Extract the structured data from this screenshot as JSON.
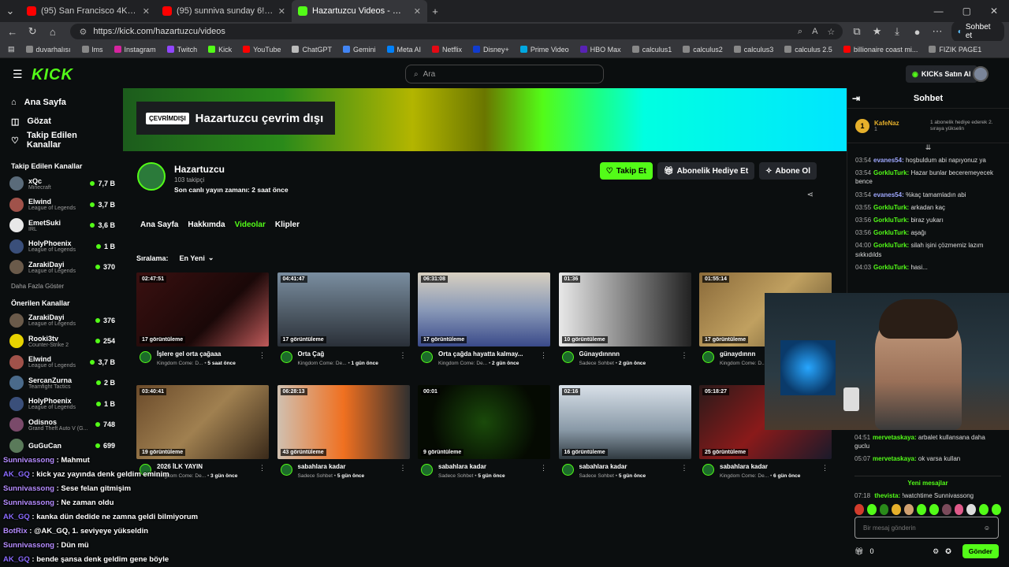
{
  "browser": {
    "tabs": [
      {
        "title": "(95) San Francisco 4K - Pacific Coa",
        "color": "#ff0000"
      },
      {
        "title": "(95) sunniva sunday 6! (singing co",
        "color": "#ff0000"
      },
      {
        "title": "Hazartuzcu Videos - Watch On-De",
        "color": "#53fc18"
      }
    ],
    "url": "https://kick.com/hazartuzcu/videos",
    "sohbet_et": "Sohbet et",
    "bookmarks": [
      {
        "label": "duvarhalısı",
        "color": "#888"
      },
      {
        "label": "lms",
        "color": "#888"
      },
      {
        "label": "Instagram",
        "color": "#d6249f"
      },
      {
        "label": "Twitch",
        "color": "#9146ff"
      },
      {
        "label": "Kick",
        "color": "#53fc18"
      },
      {
        "label": "YouTube",
        "color": "#ff0000"
      },
      {
        "label": "ChatGPT",
        "color": "#bbb"
      },
      {
        "label": "Gemini",
        "color": "#4285f4"
      },
      {
        "label": "Meta AI",
        "color": "#0081fb"
      },
      {
        "label": "Netflix",
        "color": "#e50914"
      },
      {
        "label": "Disney+",
        "color": "#113ccf"
      },
      {
        "label": "Prime Video",
        "color": "#00a8e1"
      },
      {
        "label": "HBO Max",
        "color": "#5822b4"
      },
      {
        "label": "calculus1",
        "color": "#888"
      },
      {
        "label": "calculus2",
        "color": "#888"
      },
      {
        "label": "calculus3",
        "color": "#888"
      },
      {
        "label": "calculus 2.5",
        "color": "#888"
      },
      {
        "label": "billionaire coast mi...",
        "color": "#ff0000"
      },
      {
        "label": "FIZIK PAGE1",
        "color": "#888"
      }
    ]
  },
  "header": {
    "search_placeholder": "Ara",
    "kicks_button": "KICKs Satın Al"
  },
  "sidebar": {
    "nav": [
      {
        "label": "Ana Sayfa",
        "icon": "home-icon"
      },
      {
        "label": "Gözat",
        "icon": "browse-icon"
      },
      {
        "label": "Takip Edilen Kanallar",
        "icon": "heart-icon"
      }
    ],
    "followed_heading": "Takip Edilen Kanallar",
    "followed": [
      {
        "name": "xQc",
        "game": "Minecraft",
        "viewers": "7,7 B",
        "color": "#5a6b7a"
      },
      {
        "name": "Elwind",
        "game": "League of Legends",
        "viewers": "3,7 B",
        "color": "#a0524a"
      },
      {
        "name": "EmetSuki",
        "game": "IRL",
        "viewers": "3,6 B",
        "color": "#e8e8e8"
      },
      {
        "name": "HolyPhoenix",
        "game": "League of Legends",
        "viewers": "1 B",
        "color": "#3a4f7a"
      },
      {
        "name": "ZarakiDayi",
        "game": "League of Legends",
        "viewers": "370",
        "color": "#6a5a4a"
      }
    ],
    "more_label": "Daha Fazla Göster",
    "recommended_heading": "Önerilen Kanallar",
    "recommended": [
      {
        "name": "ZarakiDayi",
        "game": "League of Legends",
        "viewers": "376",
        "color": "#6a5a4a"
      },
      {
        "name": "Rooki3tv",
        "game": "Counter-Strike 2",
        "viewers": "254",
        "color": "#e6d200"
      },
      {
        "name": "Elwind",
        "game": "League of Legends",
        "viewers": "3,7 B",
        "color": "#a0524a"
      },
      {
        "name": "SercanZurna",
        "game": "Teamfight Tactics",
        "viewers": "2 B",
        "color": "#4a6a8a"
      },
      {
        "name": "HolyPhoenix",
        "game": "League of Legends",
        "viewers": "1 B",
        "color": "#3a4f7a"
      },
      {
        "name": "Odisnos",
        "game": "Grand Theft Auto V (G...",
        "viewers": "748",
        "color": "#7a4a6a"
      },
      {
        "name": "GuGuCan",
        "game": "",
        "viewers": "699",
        "color": "#5a7a5a"
      }
    ]
  },
  "channel": {
    "offline_tag": "ÇEVRİMDIŞI",
    "offline_title": "Hazartuzcu çevrim dışı",
    "name": "Hazartuzcu",
    "followers": "103 takipçi",
    "last_stream": "Son canlı yayın zamanı: 2 saat önce",
    "follow_button": "Takip Et",
    "gift_button": "Abonelik Hediye Et",
    "subscribe_button": "Abone Ol",
    "tabs": [
      "Ana Sayfa",
      "Hakkımda",
      "Videolar",
      "Klipler"
    ],
    "sort_label": "Sıralama:",
    "sort_value": "En Yeni"
  },
  "videos": [
    {
      "duration": "02:47:51",
      "views": "17 görüntüleme",
      "title": "İşlere gel orta çağaaa",
      "game": "Kingdom Come: D...",
      "ago": "5 saat önce",
      "bg": "linear-gradient(135deg,#3a1010,#1a0808 60%,#c05a5a)"
    },
    {
      "duration": "04:41:47",
      "views": "17 görüntüleme",
      "title": "Orta Çağ",
      "game": "Kingdom Come: De...",
      "ago": "1 gün önce",
      "bg": "linear-gradient(180deg,#7a8ea0,#4a5560 60%,#2a3038)"
    },
    {
      "duration": "06:31:08",
      "views": "17 görüntüleme",
      "title": "Orta çağda hayatta kalmay...",
      "game": "Kingdom Come: De...",
      "ago": "2 gün önce",
      "bg": "linear-gradient(180deg,#d8d0c0,#8a9ab8 50%,#3a4a8a)"
    },
    {
      "duration": "01:36",
      "views": "10 görüntüleme",
      "title": "Günaydınnnn",
      "game": "Sadece Sohbet",
      "ago": "2 gün önce",
      "bg": "linear-gradient(90deg,#e8e8e8,#9a9a9a 40%,#222 100%)"
    },
    {
      "duration": "01:55:14",
      "views": "17 görüntüleme",
      "title": "günaydınnn",
      "game": "Kingdom Come: D...",
      "ago": "2 gün önce",
      "bg": "linear-gradient(135deg,#8a6a3a,#c0a060 50%,#5a4a2a)"
    },
    {
      "duration": "03:40:41",
      "views": "19 görüntüleme",
      "title": "2026 İLK YAYIN",
      "game": "Kingdom Come: De...",
      "ago": "3 gün önce",
      "bg": "linear-gradient(135deg,#6a4a2a,#a08050 50%,#3a2a1a)"
    },
    {
      "duration": "06:28:13",
      "views": "43 görüntüleme",
      "title": "sabahlara kadar",
      "game": "Sadece Sohbet",
      "ago": "5 gün önce",
      "bg": "linear-gradient(90deg,#d0c0b0,#f07020 50%,#303030)"
    },
    {
      "duration": "00:01",
      "views": "9 görüntüleme",
      "title": "sabahlara kadar",
      "game": "Sadece Sohbet",
      "ago": "5 gün önce",
      "bg": "radial-gradient(circle at 50% 50%,#1a4a0a,#050a02 70%)"
    },
    {
      "duration": "02:16",
      "views": "16 görüntüleme",
      "title": "sabahlara kadar",
      "game": "Sadece Sohbet",
      "ago": "5 gün önce",
      "bg": "linear-gradient(180deg,#d8e0e8,#8a9aa8 60%,#303a40)"
    },
    {
      "duration": "05:18:27",
      "views": "25 görüntüleme",
      "title": "sabahlara kadar",
      "game": "Kingdom Come: De...",
      "ago": "6 gün önce",
      "bg": "linear-gradient(135deg,#2a1a1a,#8a1a1a 50%,#1a1a2a)"
    }
  ],
  "chat": {
    "title": "Sohbet",
    "pinned_name": "KafeNaz",
    "pinned_count": "1",
    "pinned_text": "1 abonelik hediye ederek 2. sıraya yükselin",
    "messages": [
      {
        "time": "03:54",
        "user": "evanes54:",
        "text": "hoşbuldum abi napıyonuz ya",
        "c": "b"
      },
      {
        "time": "03:54",
        "user": "GorkluTurk:",
        "text": "Hazar bunlar beceremeyecek bence",
        "c": "g"
      },
      {
        "time": "03:54",
        "user": "evanes54:",
        "text": "%kaç tamamladın abi",
        "c": "b"
      },
      {
        "time": "03:55",
        "user": "GorkluTurk:",
        "text": "arkadan kaç",
        "c": "g"
      },
      {
        "time": "03:56",
        "user": "GorkluTurk:",
        "text": "biraz yukarı",
        "c": "g"
      },
      {
        "time": "03:56",
        "user": "GorkluTurk:",
        "text": "aşağı",
        "c": "g"
      },
      {
        "time": "04:00",
        "user": "GorkluTurk:",
        "text": "silah işini çözmemiz lazım sıkkıdılds",
        "c": "g"
      },
      {
        "time": "04:03",
        "user": "GorkluTurk:",
        "text": "hasi...",
        "c": "g"
      }
    ],
    "lower_messages": [
      {
        "time": "04:51",
        "user": "mervetaskaya:",
        "text": "arbalet kullansana daha guclu"
      },
      {
        "time": "05:07",
        "user": "mervetaskaya:",
        "text": "ok varsa kullan"
      }
    ],
    "new_messages": "Yeni mesajlar",
    "last_message": {
      "time": "07:18",
      "user": "thevista:",
      "text": "!watchtime Sunnivassong"
    },
    "input_placeholder": "Bir mesaj gönderin",
    "points": "0",
    "send_button": "Gönder"
  },
  "overlay_chat": [
    {
      "user": "Sunnivassong",
      "text": " : Mahmut"
    },
    {
      "user": "AK_GQ",
      "text": " : kick yaz yayında denk geldim eminim"
    },
    {
      "user": "Sunnivassong",
      "text": " : Sese felan gitmişim"
    },
    {
      "user": "Sunnivassong",
      "text": " : Ne zaman oldu"
    },
    {
      "user": "AK_GQ",
      "text": " : kanka dün dedide ne zamna geldi bilmiyorum"
    },
    {
      "user": "BotRix",
      "text": " : @AK_GQ, 1. seviyeye yükseldin"
    },
    {
      "user": "Sunnivassong",
      "text": " : Dün mü"
    },
    {
      "user": "AK_GQ",
      "text": " : bende şansa denk geldim gene böyle"
    }
  ],
  "colors": {
    "accent": "#53fc18",
    "bg": "#0b0e0f"
  }
}
